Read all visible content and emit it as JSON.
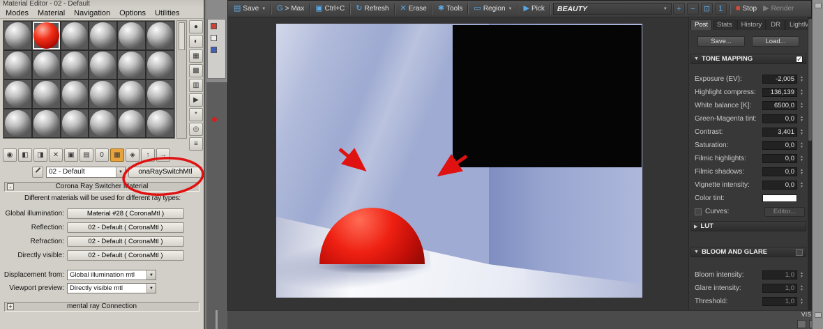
{
  "annotations": {
    "color": "#e01111"
  },
  "material_editor": {
    "title": "Material Editor - 02 - Default",
    "menu_items": [
      "Modes",
      "Material",
      "Navigation",
      "Options",
      "Utilities"
    ],
    "sample_grid": {
      "rows": 4,
      "cols": 6,
      "red_index": 1,
      "selected_index": 1
    },
    "side_tools": [
      {
        "name": "sample-type",
        "glyph": "●"
      },
      {
        "name": "backlight",
        "glyph": "◐"
      },
      {
        "name": "background",
        "glyph": "▦"
      },
      {
        "name": "sample-tiling",
        "glyph": "▩"
      },
      {
        "name": "video-color-check",
        "glyph": "▥"
      },
      {
        "name": "make-preview",
        "glyph": "▶"
      },
      {
        "name": "options",
        "glyph": "*"
      },
      {
        "name": "select-by-material",
        "glyph": "◎"
      },
      {
        "name": "material-map-navigator",
        "glyph": "≡"
      }
    ],
    "bottom_tools": [
      {
        "name": "get-material",
        "glyph": "◉"
      },
      {
        "name": "put-to-scene",
        "glyph": "◧"
      },
      {
        "name": "assign-to-selection",
        "glyph": "◨"
      },
      {
        "name": "reset-map",
        "glyph": "✕"
      },
      {
        "name": "make-unique",
        "glyph": "▣"
      },
      {
        "name": "put-to-library",
        "glyph": "▤"
      },
      {
        "name": "material-id",
        "glyph": "0"
      },
      {
        "name": "show-map-in-viewport",
        "glyph": "▦",
        "active": true
      },
      {
        "name": "show-end-result",
        "glyph": "◈"
      },
      {
        "name": "go-to-parent",
        "glyph": "↑"
      },
      {
        "name": "go-forward",
        "glyph": "→"
      }
    ],
    "name_field": "02 - Default",
    "type_field": "onaRaySwitchMtl",
    "rollouts": {
      "ray_switcher": {
        "glyph": "-",
        "title": "Corona Ray Switcher Material"
      },
      "mental_ray": {
        "glyph": "+",
        "title": "mental ray Connection"
      }
    },
    "description": "Different materials will be used for different ray types:",
    "material_rows": [
      {
        "label": "Global illumination:",
        "value": "Material #28 ( CoronaMtl )"
      },
      {
        "label": "Reflection:",
        "value": "02 - Default ( CoronaMtl )"
      },
      {
        "label": "Refraction:",
        "value": "02 - Default ( CoronaMtl )"
      },
      {
        "label": "Directly visible:",
        "value": "02 - Default ( CoronaMtl )"
      }
    ],
    "combo_rows": [
      {
        "label": "Displacement from:",
        "value": "Global illumination mtl"
      },
      {
        "label": "Viewport preview:",
        "value": "Directly visible mtl"
      }
    ]
  },
  "vfb": {
    "toolbar": {
      "buttons": [
        {
          "name": "save",
          "label": "Save",
          "glyph": "▤",
          "arrow": true
        },
        {
          "name": "send-to-max",
          "label": "> Max",
          "glyph": "G"
        },
        {
          "name": "copy",
          "label": "Ctrl+C",
          "glyph": "▣"
        },
        {
          "name": "refresh",
          "label": "Refresh",
          "glyph": "↻"
        },
        {
          "name": "erase",
          "label": "Erase",
          "glyph": "✕"
        },
        {
          "name": "tools",
          "label": "Tools",
          "glyph": "✱"
        },
        {
          "name": "region",
          "label": "Region",
          "glyph": "▭",
          "arrow": true
        },
        {
          "name": "pick",
          "label": "Pick",
          "glyph": "▶"
        }
      ],
      "channel": "BEAUTY",
      "zoom_tools": [
        {
          "name": "zoom-in",
          "glyph": "+"
        },
        {
          "name": "zoom-out",
          "glyph": "−"
        },
        {
          "name": "zoom-fit",
          "glyph": "⊡"
        },
        {
          "name": "zoom-100",
          "glyph": "1"
        }
      ],
      "stop_label": "Stop",
      "render_label": "Render"
    },
    "panel": {
      "tabs": [
        "Post",
        "Stats",
        "History",
        "DR",
        "LightMix"
      ],
      "active_tab": "Post",
      "save_button": "Save...",
      "load_button": "Load...",
      "tone_mapping": {
        "title": "TONE MAPPING",
        "enabled": true,
        "fields": [
          {
            "label": "Exposure (EV):",
            "value": "-2,005"
          },
          {
            "label": "Highlight compress:",
            "value": "136,139"
          },
          {
            "label": "White balance [K]:",
            "value": "6500,0"
          },
          {
            "label": "Green-Magenta tint:",
            "value": "0,0"
          },
          {
            "label": "Contrast:",
            "value": "3,401"
          },
          {
            "label": "Saturation:",
            "value": "0,0"
          },
          {
            "label": "Filmic highlights:",
            "value": "0,0"
          },
          {
            "label": "Filmic shadows:",
            "value": "0,0"
          },
          {
            "label": "Vignette intensity:",
            "value": "0,0"
          }
        ],
        "color_tint_label": "Color tint:",
        "color_tint_value": "#ffffff",
        "curves_label": "Curves:",
        "editor_button": "Editor..."
      },
      "lut": {
        "title": "LUT"
      },
      "bloom_glare": {
        "title": "BLOOM AND GLARE",
        "enabled": false,
        "fields": [
          {
            "label": "Bloom intensity:",
            "value": "1,0"
          },
          {
            "label": "Glare intensity:",
            "value": "1,0"
          },
          {
            "label": "Threshold:",
            "value": "1,0"
          }
        ]
      }
    },
    "render_view": {
      "subject": "room corner with red hemisphere",
      "colors": {
        "wall": "#9fabd2",
        "floor": "#f2f3f7",
        "dome": "#e01808",
        "window": "#050505"
      }
    }
  },
  "background": {
    "visib_label": "VISIB"
  }
}
